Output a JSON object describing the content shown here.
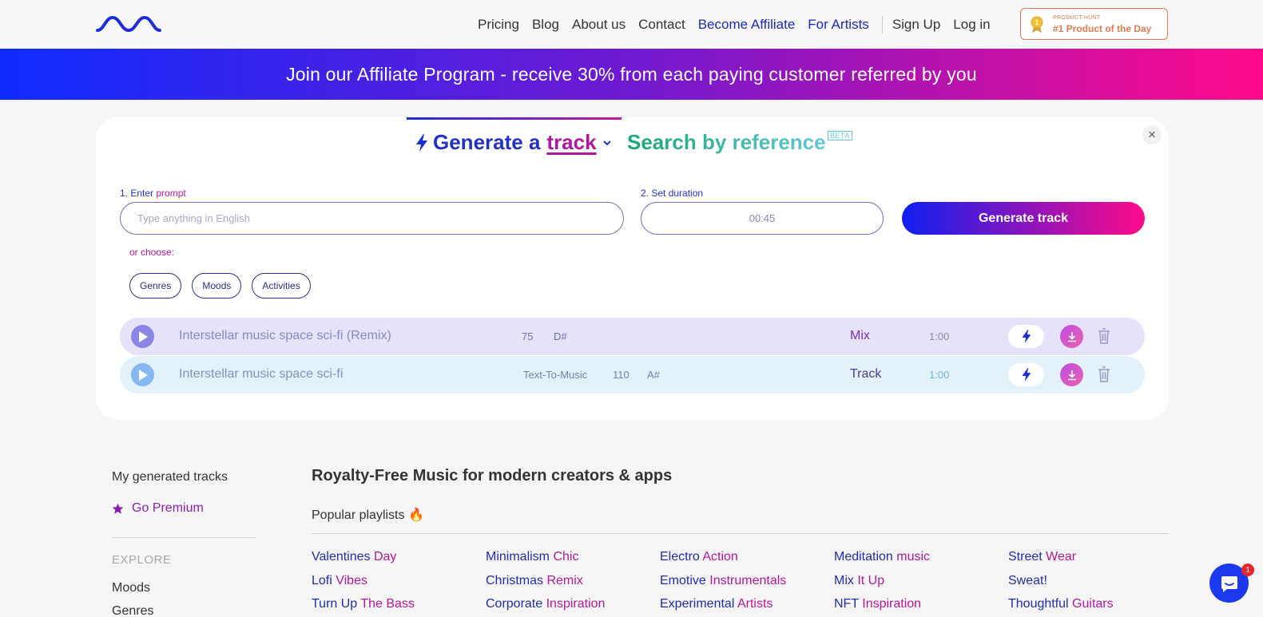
{
  "header": {
    "logo_icon": "wave-logo-icon",
    "nav": [
      {
        "label": "Pricing",
        "color": "#333333"
      },
      {
        "label": "Blog",
        "color": "#333333"
      },
      {
        "label": "About us",
        "color": "#333333"
      },
      {
        "label": "Contact",
        "color": "#333333"
      },
      {
        "label": "Become Affiliate",
        "color": "#1b2bb8"
      },
      {
        "label": "For Artists",
        "color": "#1b2bb8"
      }
    ],
    "auth": [
      {
        "label": "Sign Up"
      },
      {
        "label": "Log in"
      }
    ],
    "product_hunt": {
      "small": "PRODUCT HUNT",
      "big": "#1 Product of the Day",
      "color": "#e07a52"
    }
  },
  "banner": {
    "text": "Join our Affiliate Program - receive 30% from each paying customer referred by you"
  },
  "generator": {
    "tab_generate_a": "Generate a",
    "tab_generate_track": "track",
    "tab_search": "Search by reference",
    "beta": "BETA",
    "close": "×",
    "prompt_label_num": "1. Enter",
    "prompt_label_word": "prompt",
    "prompt_placeholder": "Type anything in English",
    "prompt_value": "",
    "duration_label": "2. Set duration",
    "duration_value": "00:45",
    "generate_button": "Generate track",
    "or_choose": "or choose:",
    "chips": [
      "Genres",
      "Moods",
      "Activities"
    ]
  },
  "tracks": [
    {
      "name": "Interstellar music space sci-fi (Remix)",
      "source": "",
      "bpm": "75",
      "key": "D#",
      "type": "Mix",
      "duration": "1:00"
    },
    {
      "name": "Interstellar music space sci-fi",
      "source": "Text-To-Music",
      "bpm": "110",
      "key": "A#",
      "type": "Track",
      "duration": "1:00"
    }
  ],
  "sidebar": {
    "title": "My generated tracks",
    "go_premium": "Go Premium",
    "explore": "EXPLORE",
    "links": [
      "Moods",
      "Genres"
    ]
  },
  "main": {
    "title": "Royalty-Free Music for modern creators & apps",
    "popular": "Popular playlists 🔥",
    "playlists": [
      [
        {
          "a": "Valentines",
          "b": " Day"
        },
        {
          "a": "Lofi",
          "b": " Vibes"
        },
        {
          "a": "Turn Up",
          "b": " The Bass"
        }
      ],
      [
        {
          "a": "Minimalism",
          "b": " Chic"
        },
        {
          "a": "Christmas",
          "b": " Remix"
        },
        {
          "a": "Corporate",
          "b": " Inspiration"
        }
      ],
      [
        {
          "a": "Electro",
          "b": " Action"
        },
        {
          "a": "Emotive",
          "b": " Instrumentals"
        },
        {
          "a": "Experimental",
          "b": " Artists"
        }
      ],
      [
        {
          "a": "Meditation",
          "b": " music"
        },
        {
          "a": "Mix",
          "b": " It Up"
        },
        {
          "a": "NFT",
          "b": " Inspiration"
        }
      ],
      [
        {
          "a": "Street",
          "b": " Wear"
        },
        {
          "a": "Sweat!",
          "b": ""
        },
        {
          "a": "Thoughtful",
          "b": " Guitars"
        }
      ]
    ]
  },
  "chat": {
    "badge": "1",
    "icon": "chat-bubble-icon"
  },
  "colors": {
    "brand_blue": "#1d2ed8",
    "brand_pink": "#b3179b",
    "teal": "#1aa674"
  }
}
